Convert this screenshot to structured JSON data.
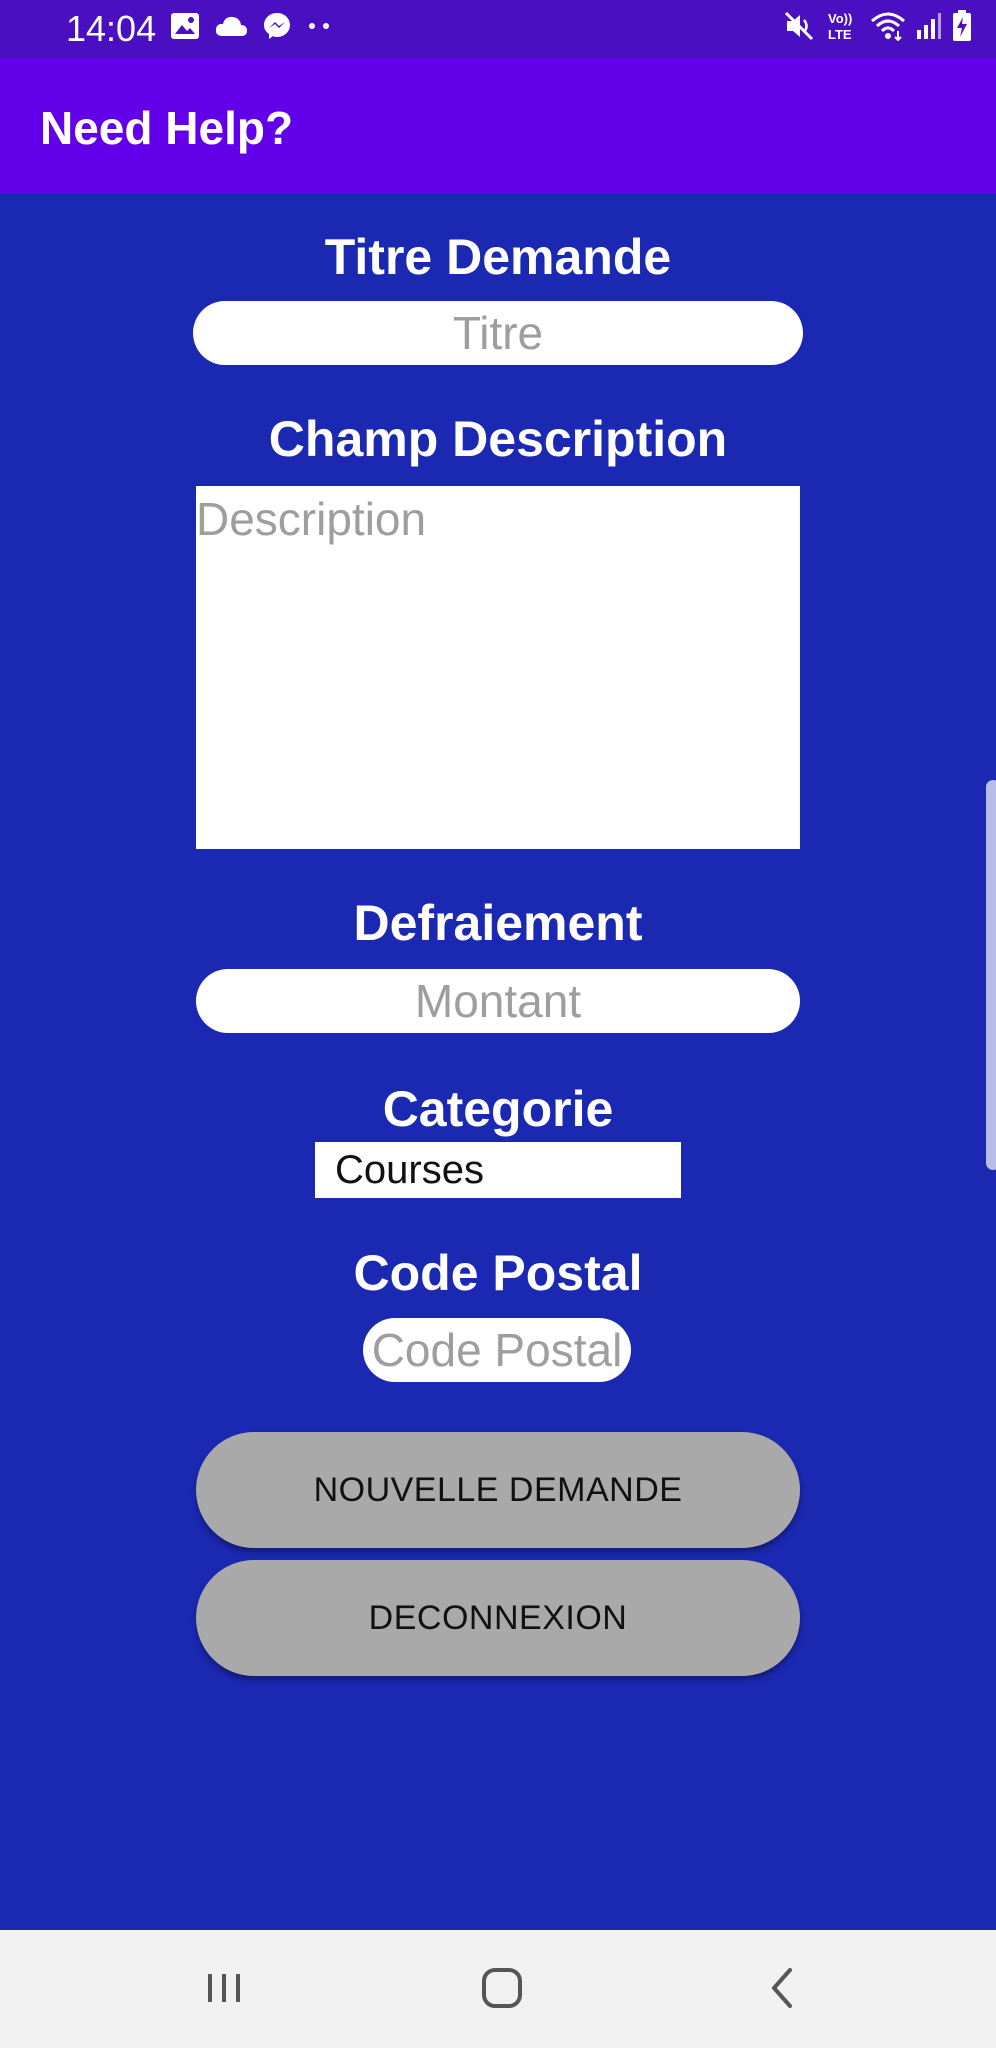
{
  "status_bar": {
    "time": "14:04",
    "left_icons": [
      "image-icon",
      "cloud-icon",
      "messenger-icon",
      "more-dots-icon"
    ],
    "right_icons": [
      "mute-icon",
      "volte-icon",
      "wifi-icon",
      "signal-icon",
      "battery-charging-icon"
    ],
    "volte_text": "Vo)) LTE"
  },
  "app_bar": {
    "title": "Need Help?"
  },
  "form": {
    "title_label": "Titre Demande",
    "title_placeholder": "Titre",
    "description_label": "Champ Description",
    "description_placeholder": "Description",
    "compensation_label": "Defraiement",
    "compensation_placeholder": "Montant",
    "category_label": "Categorie",
    "category_value": "Courses",
    "postal_label": "Code Postal",
    "postal_placeholder": "Code Postal"
  },
  "buttons": {
    "new_request": "NOUVELLE DEMANDE",
    "logout": "DECONNEXION"
  },
  "nav_bar": {
    "icons": [
      "recent-apps-icon",
      "home-icon",
      "back-icon"
    ]
  },
  "colors": {
    "status_bar": "#4a0fc0",
    "app_bar": "#6200ea",
    "background": "#1b29b2",
    "button": "#a9a9a9",
    "nav_bar": "#f1f1f1"
  }
}
